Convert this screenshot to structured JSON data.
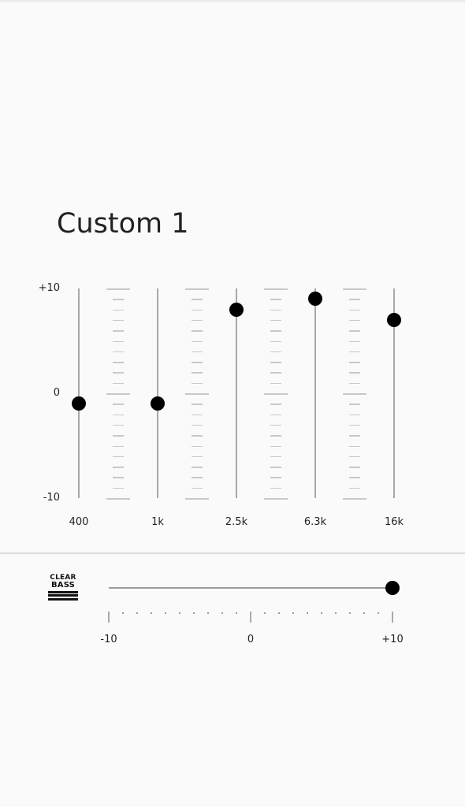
{
  "preset_title": "Custom 1",
  "equalizer": {
    "range": [
      -10,
      10
    ],
    "y_labels": [
      "+10",
      "0",
      "-10"
    ],
    "bands": [
      {
        "label": "400",
        "value": -1
      },
      {
        "label": "1k",
        "value": -1
      },
      {
        "label": "2.5k",
        "value": 8
      },
      {
        "label": "6.3k",
        "value": 9
      },
      {
        "label": "16k",
        "value": 7
      }
    ]
  },
  "clear_bass": {
    "logo_text": [
      "CLEAR",
      "BASS"
    ],
    "value": 10,
    "range": [
      -10,
      10
    ],
    "labels": [
      "-10",
      "0",
      "+10"
    ]
  },
  "colors": {
    "thumb": "#000000",
    "track": "#a8a8a8",
    "background": "#fafafa"
  }
}
